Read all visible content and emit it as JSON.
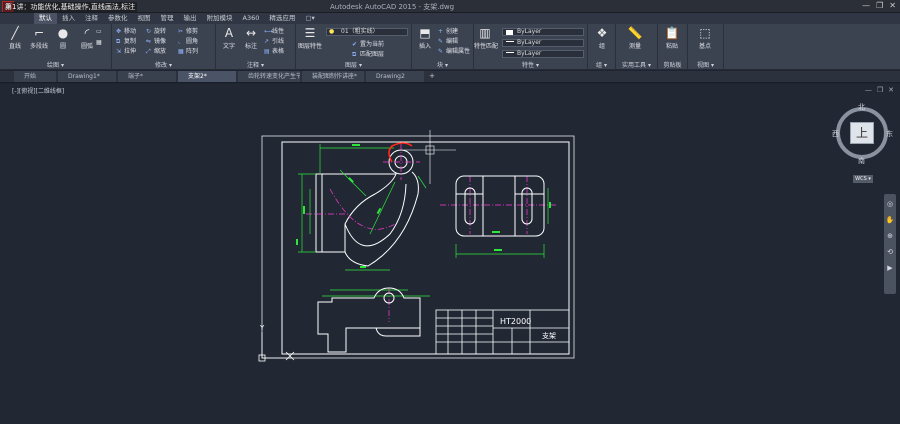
{
  "window": {
    "overlay_title": "第1讲：功能优化,基础操作,直线画法,标注",
    "doc_title": "Autodesk AutoCAD 2015 - 支架.dwg",
    "logo": "A"
  },
  "ribbon_tabs": [
    "默认",
    "插入",
    "注释",
    "参数化",
    "视图",
    "管理",
    "输出",
    "附加模块",
    "A360",
    "精选应用",
    "▢▾"
  ],
  "panels": {
    "draw": {
      "title": "绘图 ▾",
      "tools": [
        "直线",
        "多段线",
        "圆",
        "圆弧"
      ]
    },
    "modify": {
      "title": "修改 ▾",
      "tools": [
        "移动",
        "旋转",
        "修剪",
        "复制",
        "镜像",
        "圆角",
        "拉伸",
        "缩放",
        "阵列"
      ]
    },
    "annotation": {
      "title": "注释 ▾",
      "tools": [
        "文字",
        "标注",
        "线性",
        "引线",
        "表格"
      ]
    },
    "layers": {
      "title": "图层 ▾",
      "tools": [
        "图层特性",
        "置为当前",
        "匹配图层"
      ],
      "current_layer": "01（粗实线）"
    },
    "block": {
      "title": "块 ▾",
      "tools": [
        "插入",
        "创建",
        "编辑",
        "编辑属性"
      ]
    },
    "properties": {
      "title": "特性 ▾",
      "tools": [
        "特性匹配"
      ],
      "color": "ByLayer",
      "linetype": "ByLayer",
      "lineweight": "ByLayer"
    },
    "groups": {
      "title": "组 ▾",
      "tools": [
        "组"
      ]
    },
    "utilities": {
      "title": "实用工具 ▾",
      "tools": [
        "测量"
      ]
    },
    "clipboard": {
      "title": "剪贴板",
      "tools": [
        "粘贴"
      ]
    },
    "view": {
      "title": "视图 ▾",
      "tools": [
        "基点"
      ]
    }
  },
  "file_tabs": [
    "开始",
    "Drawing1*",
    "端子*",
    "支架2*",
    "齿轮转速变化产生节奏*",
    "装配图制作讲座*",
    "Drawing2"
  ],
  "active_file_tab": "支架2*",
  "viewport": {
    "label": "[-][俯视][二维线框]",
    "controls": [
      "—",
      "❐",
      "✕"
    ]
  },
  "viewcube": {
    "north": "北",
    "south": "南",
    "east": "东",
    "west": "西",
    "face": "上",
    "wcs": "WCS ▾"
  },
  "title_block": {
    "drawing_number": "HT2000",
    "part_name": "支架"
  },
  "ucs": {
    "y": "Y"
  },
  "colors": {
    "background": "#212834",
    "ribbon": "#3b4250",
    "dimension": "#2ee63a",
    "centerline": "#ff3bd8",
    "red_mark": "#ff2a1a"
  }
}
